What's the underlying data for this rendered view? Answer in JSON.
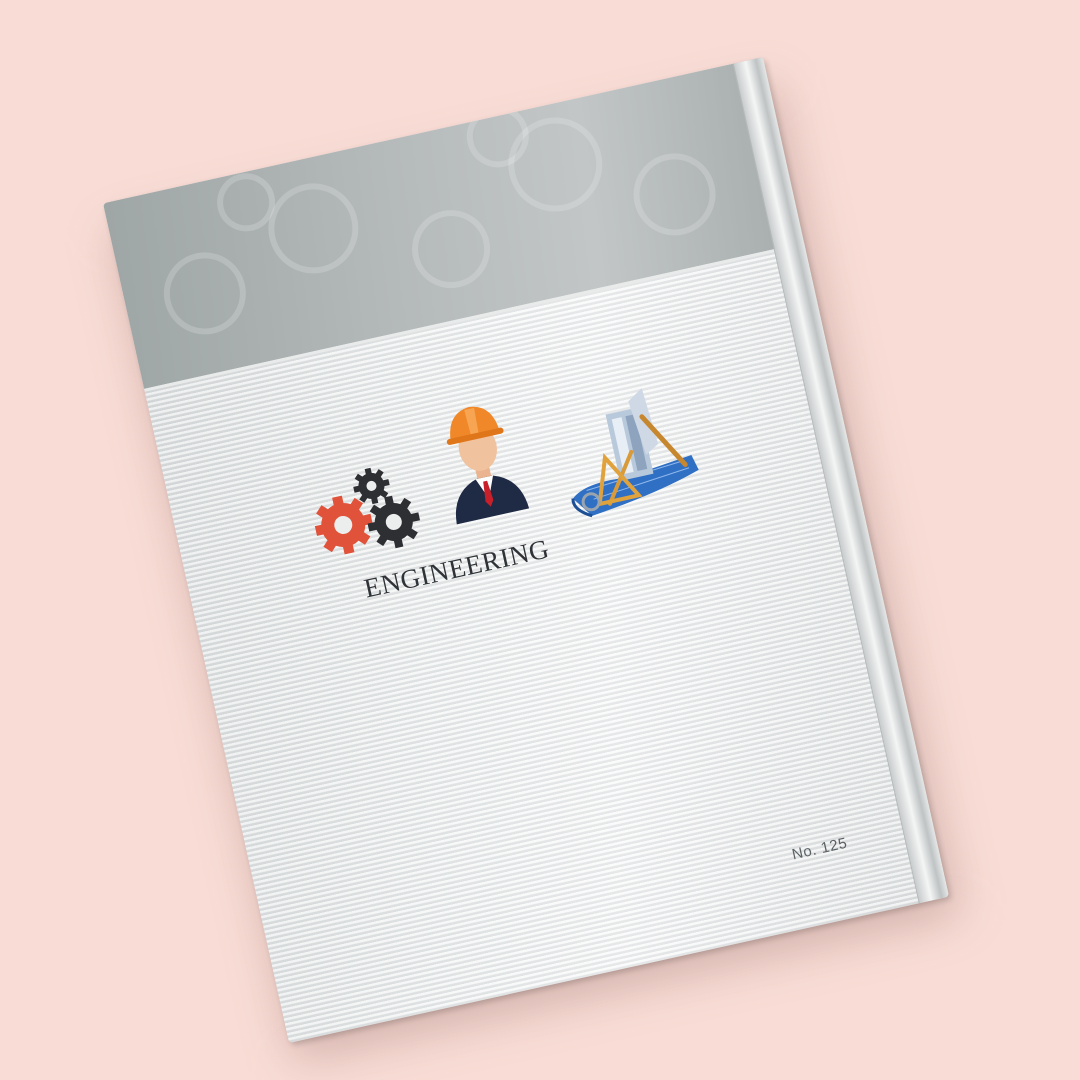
{
  "cover": {
    "title": "ENGINEERING",
    "number": "No. 125"
  },
  "icons": [
    "gears-icon",
    "engineer-icon",
    "blueprint-icon"
  ],
  "colors": {
    "background": "#f8dcd5",
    "band": "#b4b9b9",
    "cover": "#eceeee",
    "gear_accent": "#e0533a",
    "gear_dark": "#2d2f33",
    "helmet": "#f0882a",
    "blueprint": "#2f6fc4"
  }
}
